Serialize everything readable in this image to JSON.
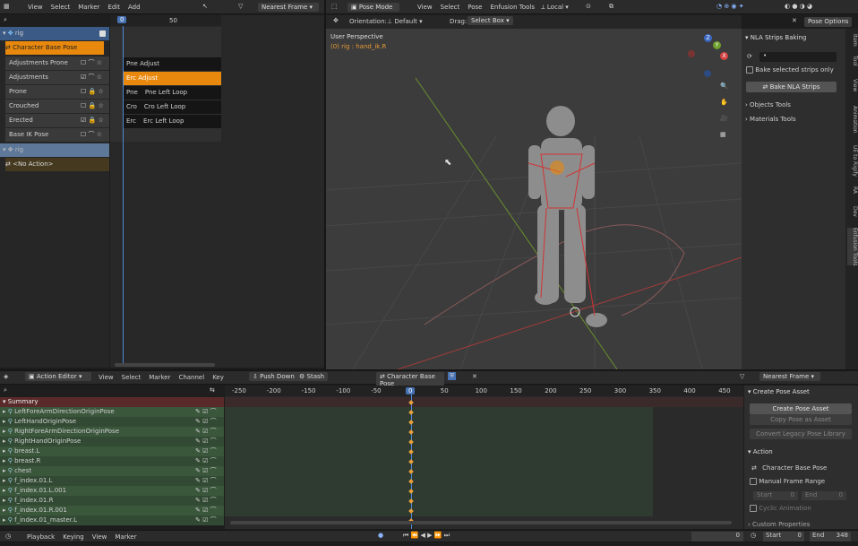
{
  "nla": {
    "menu": [
      "View",
      "Select",
      "Marker",
      "Edit",
      "Add"
    ],
    "snap": "Nearest Frame",
    "frame_labels": [
      "0",
      "50"
    ],
    "tracks": [
      {
        "label": "rig",
        "type": "object"
      },
      {
        "label": "Character Base Pose",
        "type": "strip-active"
      },
      {
        "label": "Adjustments Prone"
      },
      {
        "label": "Adjustments"
      },
      {
        "label": "Prone"
      },
      {
        "label": "Crouched"
      },
      {
        "label": "Erected"
      },
      {
        "label": "Base IK Pose"
      },
      {
        "label": "rig",
        "type": "object2"
      },
      {
        "label": "<No Action>",
        "type": "noaction"
      }
    ],
    "strips": [
      {
        "short": "",
        "label": "Pne Adjust"
      },
      {
        "short": "",
        "label": "Erc Adjust",
        "active": true
      },
      {
        "short": "Pne",
        "label": "Pne Left Loop"
      },
      {
        "short": "Cro",
        "label": "Cro Left Loop"
      },
      {
        "short": "Erc",
        "label": "Erc Left Loop"
      }
    ]
  },
  "viewport": {
    "mode": "Pose Mode",
    "menu": [
      "View",
      "Select",
      "Pose",
      "Enfusion Tools"
    ],
    "transform": "Local",
    "orientation_label": "Orientation:",
    "orientation": "Default",
    "drag_label": "Drag:",
    "drag": "Select Box",
    "pose_options": "Pose Options",
    "perspective": "User Perspective",
    "object_info": "(0) rig : hand_ik.R",
    "axes": [
      "X",
      "Y",
      "Z"
    ],
    "tabs": [
      "Item",
      "Tool",
      "View",
      "Animation",
      "UE to Rigify",
      "RA",
      "Dev",
      "Enfusion Tools"
    ],
    "sidebar": {
      "section": "NLA Strips Baking",
      "field": "•",
      "bake_selected": "Bake selected strips only",
      "bake_button": "Bake NLA Strips",
      "objects_tools": "Objects Tools",
      "materials_tools": "Materials Tools"
    }
  },
  "action_editor": {
    "mode": "Action Editor",
    "menu": [
      "View",
      "Select",
      "Marker",
      "Channel",
      "Key"
    ],
    "push_down": "Push Down",
    "stash": "Stash",
    "action": "Character Base Pose",
    "snap": "Nearest Frame",
    "ruler": [
      "-250",
      "-200",
      "-150",
      "-100",
      "-50",
      "0",
      "50",
      "100",
      "150",
      "200",
      "250",
      "300",
      "350",
      "400",
      "450"
    ],
    "summary": "Summary",
    "channels": [
      "LeftForeArmDirectionOriginPose",
      "LeftHandOriginPose",
      "RightForeArmDirectionOriginPose",
      "RightHandOriginPose",
      "breast.L",
      "breast.R",
      "chest",
      "f_index.01.L",
      "f_index.01.L.001",
      "f_index.01.R",
      "f_index.01.R.001",
      "f_index.01_master.L"
    ],
    "panel": {
      "section1": "Create Pose Asset",
      "create_btn": "Create Pose Asset",
      "copy_btn": "Copy Pose as Asset",
      "convert_btn": "Convert Legacy Pose Library",
      "section2": "Action",
      "action_name": "Character Base Pose",
      "manual_range": "Manual Frame Range",
      "start_label": "Start",
      "start_val": "0",
      "end_label": "End",
      "end_val": "0",
      "cyclic": "Cyclic Animation",
      "section3": "Custom Properties"
    }
  },
  "timeline": {
    "menu": [
      "Playback",
      "Keying",
      "View",
      "Marker"
    ],
    "current": "0",
    "start_label": "Start",
    "start": "0",
    "end_label": "End",
    "end": "348"
  },
  "colors": {
    "accent": "#4772b3",
    "strip_active": "#e8880d",
    "green_row": "#3c5b3c",
    "orange_row": "#8a5a29",
    "playhead": "#4d8ad8"
  }
}
